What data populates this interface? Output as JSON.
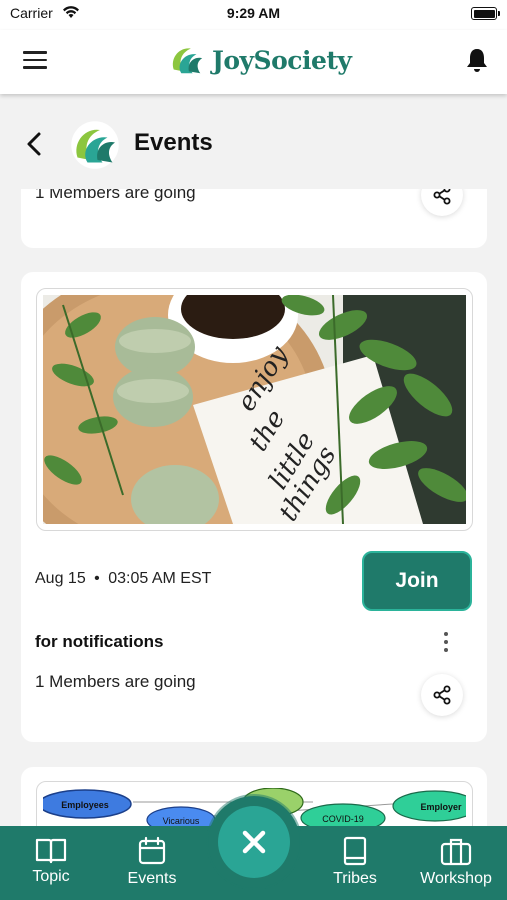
{
  "status_bar": {
    "carrier": "Carrier",
    "time": "9:29 AM"
  },
  "header": {
    "brand_name": "JoySociety",
    "menu_icon": "hamburger-menu-icon",
    "notification_icon": "bell-icon"
  },
  "page": {
    "title": "Events",
    "back_icon": "chevron-left-icon"
  },
  "events": [
    {
      "going": "1 Members are going"
    },
    {
      "date": "Aug 15",
      "separator": "•",
      "time": "03:05 AM EST",
      "join_label": "Join",
      "name": "for notifications",
      "going": "1 Members are going",
      "image_text": [
        "enjoy",
        "the",
        "little",
        "things"
      ]
    },
    {
      "diagram_labels": [
        "Employees",
        "Vicarious",
        "COVID-19",
        "Employer"
      ]
    }
  ],
  "bottom_nav": {
    "items": [
      {
        "label": "Topic",
        "icon": "book-open-icon"
      },
      {
        "label": "Events",
        "icon": "calendar-icon"
      },
      {
        "label": "Tribes",
        "icon": "book-icon"
      },
      {
        "label": "Workshop",
        "icon": "briefcase-icon"
      }
    ],
    "fab_icon": "close-icon"
  },
  "colors": {
    "brand": "#1f7a6a",
    "brand_light": "#2aa595",
    "background": "#f2f2f2"
  }
}
